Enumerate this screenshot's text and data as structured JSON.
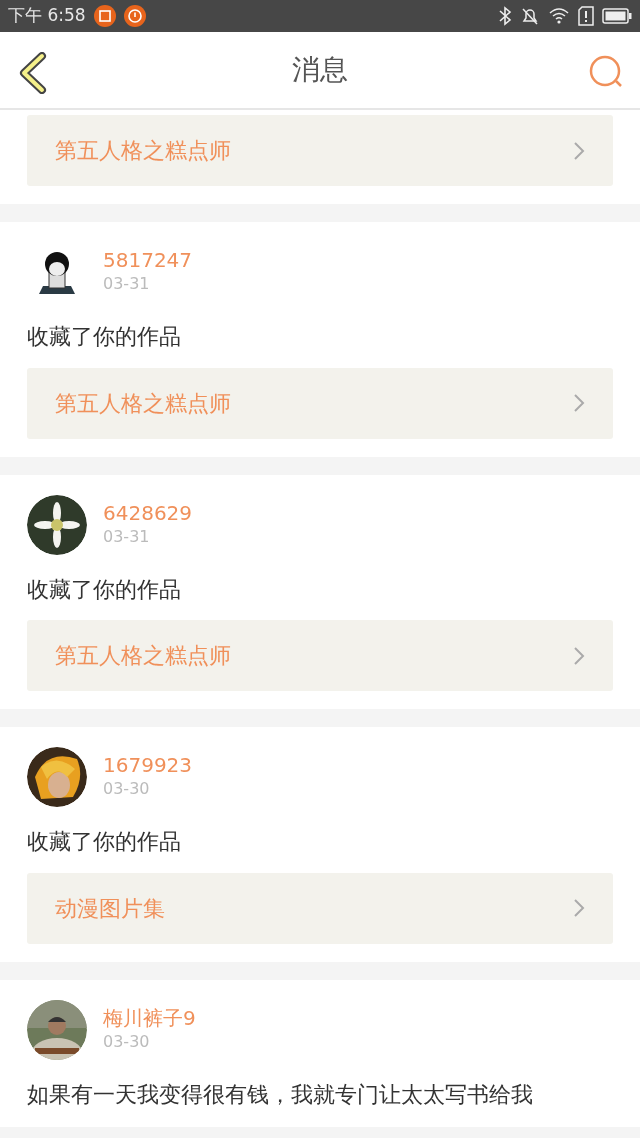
{
  "status_bar": {
    "time": "下午 6:58"
  },
  "header": {
    "title": "消息"
  },
  "messages": [
    {
      "link": "第五人格之糕点师"
    },
    {
      "user": "5817247",
      "date": "03-31",
      "text": "收藏了你的作品",
      "link": "第五人格之糕点师"
    },
    {
      "user": "6428629",
      "date": "03-31",
      "text": "收藏了你的作品",
      "link": "第五人格之糕点师"
    },
    {
      "user": "1679923",
      "date": "03-30",
      "text": "收藏了你的作品",
      "link": "动漫图片集"
    },
    {
      "user": "梅川裤子9",
      "date": "03-30",
      "text": "如果有一天我变得很有钱，我就专门让太太写书给我"
    }
  ]
}
